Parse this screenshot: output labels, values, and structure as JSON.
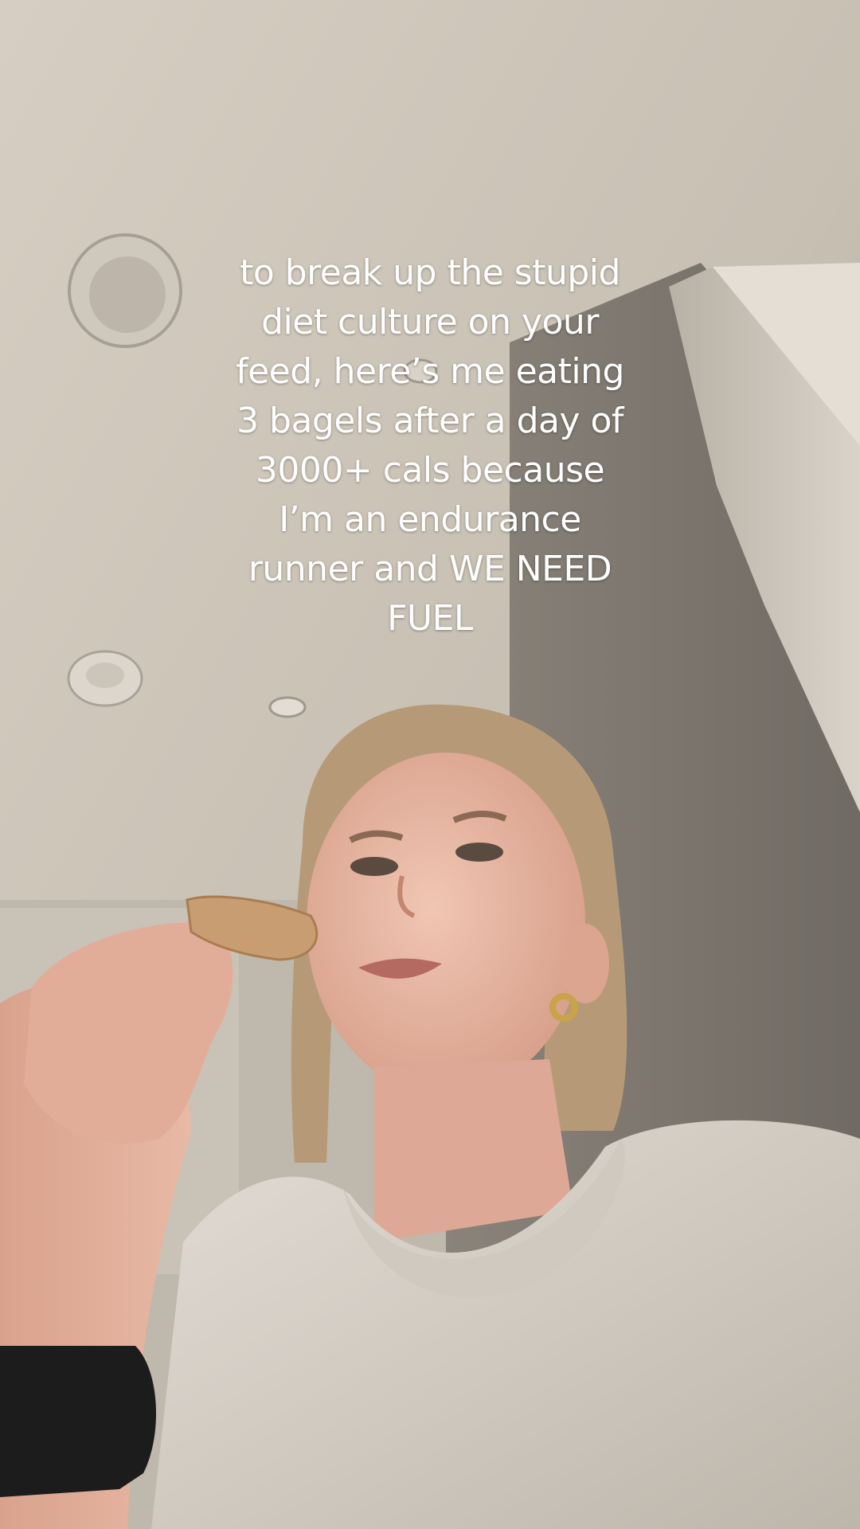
{
  "caption": {
    "lines": [
      "to break up the stupid",
      "diet culture on your",
      "feed, here’s me eating",
      "3 bagels after a day of",
      "3000+ cals because",
      "I’m an endurance",
      "runner and WE NEED",
      "FUEL"
    ]
  },
  "colors": {
    "ceiling": "#d8d0c4",
    "wall_shadow": "#7a746b",
    "hoodie": "#d9d4cc",
    "skin": "#e2b4a0",
    "hair": "#b69a78",
    "watch": "#1c1c1c",
    "caption_text": "#ffffff"
  },
  "scene_objects": [
    "ceiling-vent",
    "smoke-detector",
    "recessed-light",
    "cabinet-corner",
    "woman-eating-bagel",
    "black-watch",
    "gold-earring"
  ]
}
